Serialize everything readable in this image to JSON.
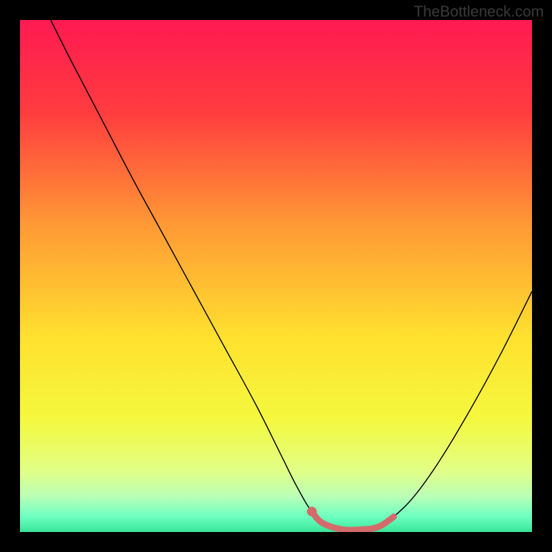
{
  "watermark": "TheBottleneck.com",
  "chart_data": {
    "type": "line",
    "title": "",
    "xlabel": "",
    "ylabel": "",
    "xlim": [
      0,
      100
    ],
    "ylim": [
      0,
      100
    ],
    "background_gradient": {
      "stops": [
        {
          "offset": 0.0,
          "color": "#ff1a52"
        },
        {
          "offset": 0.18,
          "color": "#ff3c3f"
        },
        {
          "offset": 0.4,
          "color": "#ff9935"
        },
        {
          "offset": 0.62,
          "color": "#ffe12f"
        },
        {
          "offset": 0.78,
          "color": "#f4f83e"
        },
        {
          "offset": 0.88,
          "color": "#e2ff86"
        },
        {
          "offset": 0.93,
          "color": "#baffb7"
        },
        {
          "offset": 0.97,
          "color": "#6dffc0"
        },
        {
          "offset": 1.0,
          "color": "#38e59a"
        }
      ]
    },
    "series": [
      {
        "name": "curve",
        "type": "line",
        "color": "#000000",
        "width": 1.5,
        "points": [
          {
            "x": 6.0,
            "y": 100.0
          },
          {
            "x": 10.0,
            "y": 92.0
          },
          {
            "x": 16.0,
            "y": 80.5
          },
          {
            "x": 22.0,
            "y": 69.0
          },
          {
            "x": 28.0,
            "y": 58.0
          },
          {
            "x": 34.0,
            "y": 47.0
          },
          {
            "x": 40.0,
            "y": 36.0
          },
          {
            "x": 46.0,
            "y": 25.0
          },
          {
            "x": 51.0,
            "y": 15.0
          },
          {
            "x": 54.0,
            "y": 9.0
          },
          {
            "x": 57.0,
            "y": 4.0
          },
          {
            "x": 60.0,
            "y": 1.5
          },
          {
            "x": 63.0,
            "y": 0.5
          },
          {
            "x": 67.0,
            "y": 0.5
          },
          {
            "x": 70.0,
            "y": 1.0
          },
          {
            "x": 73.0,
            "y": 3.0
          },
          {
            "x": 77.0,
            "y": 7.0
          },
          {
            "x": 82.0,
            "y": 14.0
          },
          {
            "x": 88.0,
            "y": 24.0
          },
          {
            "x": 94.0,
            "y": 35.0
          },
          {
            "x": 100.0,
            "y": 47.0
          }
        ]
      },
      {
        "name": "highlight",
        "type": "line",
        "color": "#d46a6a",
        "width": 9,
        "cap": "round",
        "points": [
          {
            "x": 57.0,
            "y": 4.0
          },
          {
            "x": 59.0,
            "y": 1.8
          },
          {
            "x": 63.0,
            "y": 0.5
          },
          {
            "x": 67.0,
            "y": 0.5
          },
          {
            "x": 70.0,
            "y": 1.0
          },
          {
            "x": 72.5,
            "y": 2.6
          },
          {
            "x": 73.0,
            "y": 3.0
          }
        ]
      },
      {
        "name": "marker",
        "type": "scatter",
        "color": "#d46a6a",
        "radius": 7,
        "points": [
          {
            "x": 57.0,
            "y": 4.0
          }
        ]
      }
    ]
  }
}
